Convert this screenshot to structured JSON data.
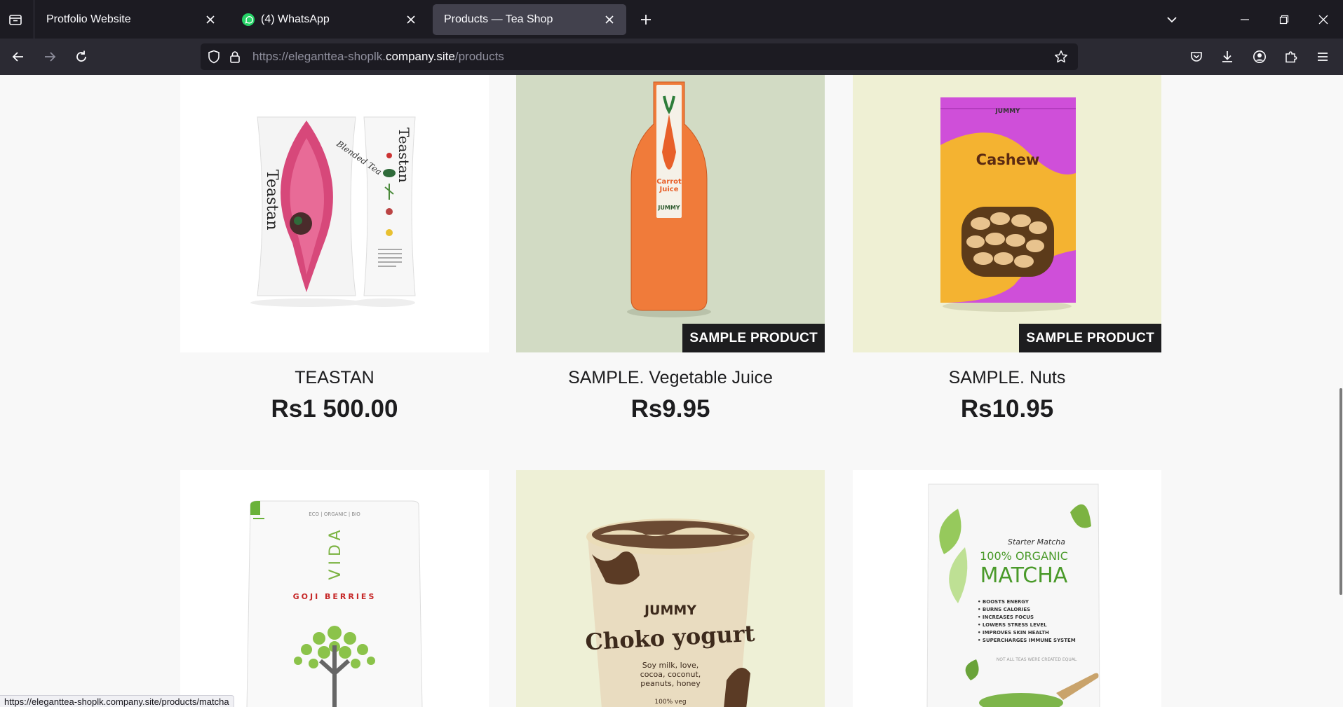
{
  "browser": {
    "tabs": [
      {
        "title": "Protfolio Website",
        "icon": "none",
        "active": false
      },
      {
        "title": "(4) WhatsApp",
        "icon": "whatsapp-icon",
        "active": false
      },
      {
        "title": "Products — Tea Shop",
        "icon": "none",
        "active": true
      }
    ],
    "url": {
      "scheme": "https://",
      "subdomain": "eleganttea-shoplk.",
      "host": "company.site",
      "path": "/products"
    },
    "status_link": "https://eleganttea-shoplk.company.site/products/matcha"
  },
  "products_row1": [
    {
      "name": "TEASTAN",
      "price": "Rs1 500.00",
      "badge": "",
      "bg": "#ffffff"
    },
    {
      "name": "SAMPLE. Vegetable Juice",
      "price": "Rs9.95",
      "badge": "SAMPLE PRODUCT",
      "bg": "#d4dcc6"
    },
    {
      "name": "SAMPLE. Nuts",
      "price": "Rs10.95",
      "badge": "SAMPLE PRODUCT",
      "bg": "#eff0d4"
    }
  ],
  "products_row2": [
    {
      "bg": "#ffffff"
    },
    {
      "bg": "#eef0d6"
    },
    {
      "bg": "#ffffff"
    }
  ],
  "image_text": {
    "teastan_brand": "Teastan",
    "teastan_sub": "Blended Tea",
    "juice_label": "Carrot Juice",
    "juice_brand": "JUMMY",
    "nuts_brand": "JUMMY",
    "nuts_label": "Cashew",
    "vida_top": "ECO | ORGANIC | BIO",
    "vida_brand": "VIDA",
    "vida_label": "GOJI BERRIES",
    "yogurt_brand": "JUMMY",
    "yogurt_label": "Choko yogurt",
    "yogurt_desc": "Soy milk, love, cocoa, coconut, peanuts, honey",
    "yogurt_veg": "100% veg",
    "matcha_starter": "Starter Matcha",
    "matcha_organic": "100% ORGANIC",
    "matcha_title": "MATCHA",
    "matcha_benefits": [
      "BOOSTS ENERGY",
      "BURNS CALORIES",
      "INCREASES FOCUS",
      "LOWERS STRESS LEVEL",
      "IMPROVES SKIN HEALTH",
      "SUPERCHARGES IMMUNE SYSTEM"
    ],
    "matcha_note": "NOT ALL TEAS WERE CREATED EQUAL"
  },
  "colors": {
    "chrome_dark": "#1c1b22",
    "chrome": "#2b2a33",
    "active_tab": "#42414d",
    "page_bg": "#f8f8f8",
    "text": "#1d1d1f"
  }
}
